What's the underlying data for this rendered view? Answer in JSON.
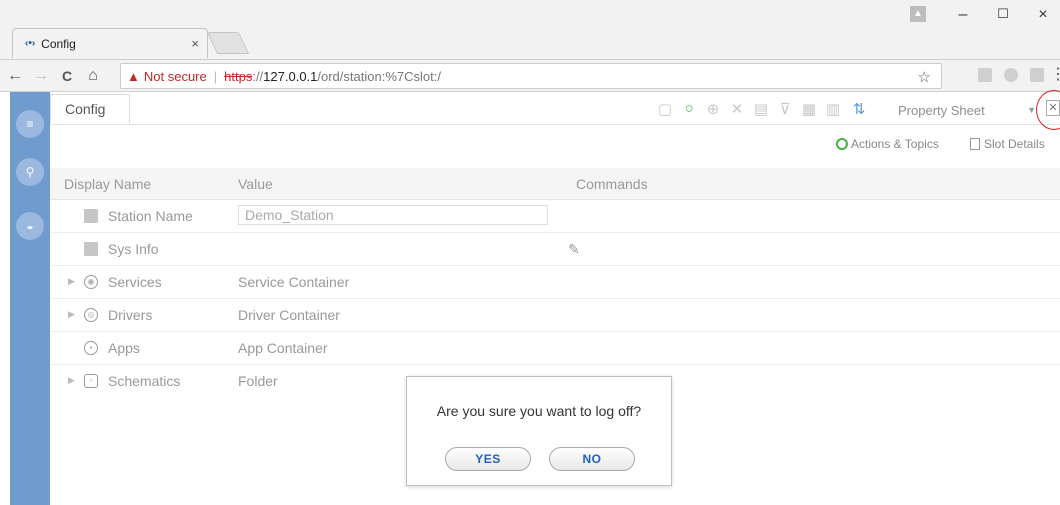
{
  "browser": {
    "tab_title": "Config",
    "tab_favicon": "‹•›",
    "tab_close": "×",
    "window_minimize": "–",
    "window_maximize": "☐",
    "window_close": "×",
    "nav_back": "←",
    "nav_forward": "→",
    "nav_reload": "C",
    "nav_home": "⌂",
    "security_label": "Not secure",
    "url_scheme": "https",
    "url_scheme_suffix": "://",
    "url_host": "127.0.0.1",
    "url_path": "/ord/station:%7Cslot:/",
    "bookmark_star": "☆",
    "menu_dots": "⋮"
  },
  "app": {
    "tab_label": "Config",
    "view_selector": "Property Sheet",
    "actions_topics": "Actions & Topics",
    "slot_details": "Slot Details"
  },
  "table": {
    "headers": {
      "name": "Display Name",
      "value": "Value",
      "commands": "Commands"
    },
    "rows": [
      {
        "name": "Station Name",
        "value": "Demo_Station",
        "icon": "folder-icon",
        "expandable": false
      },
      {
        "name": "Sys Info",
        "value": "",
        "icon": "folder-icon",
        "expandable": false,
        "command": "✎"
      },
      {
        "name": "Services",
        "value": "Service Container",
        "icon": "services-icon",
        "expandable": true
      },
      {
        "name": "Drivers",
        "value": "Driver Container",
        "icon": "drivers-icon",
        "expandable": true
      },
      {
        "name": "Apps",
        "value": "App Container",
        "icon": "apps-icon",
        "expandable": false
      },
      {
        "name": "Schematics",
        "value": "Folder",
        "icon": "schematics-icon",
        "expandable": true
      }
    ]
  },
  "dialog": {
    "message": "Are you sure you want to log off?",
    "yes_label": "YES",
    "no_label": "NO"
  },
  "colors": {
    "rail": "#6f9bcf",
    "accent_green": "#3fb348",
    "dialog_button_text": "#1f5fbf",
    "warning_red": "#c62828"
  }
}
